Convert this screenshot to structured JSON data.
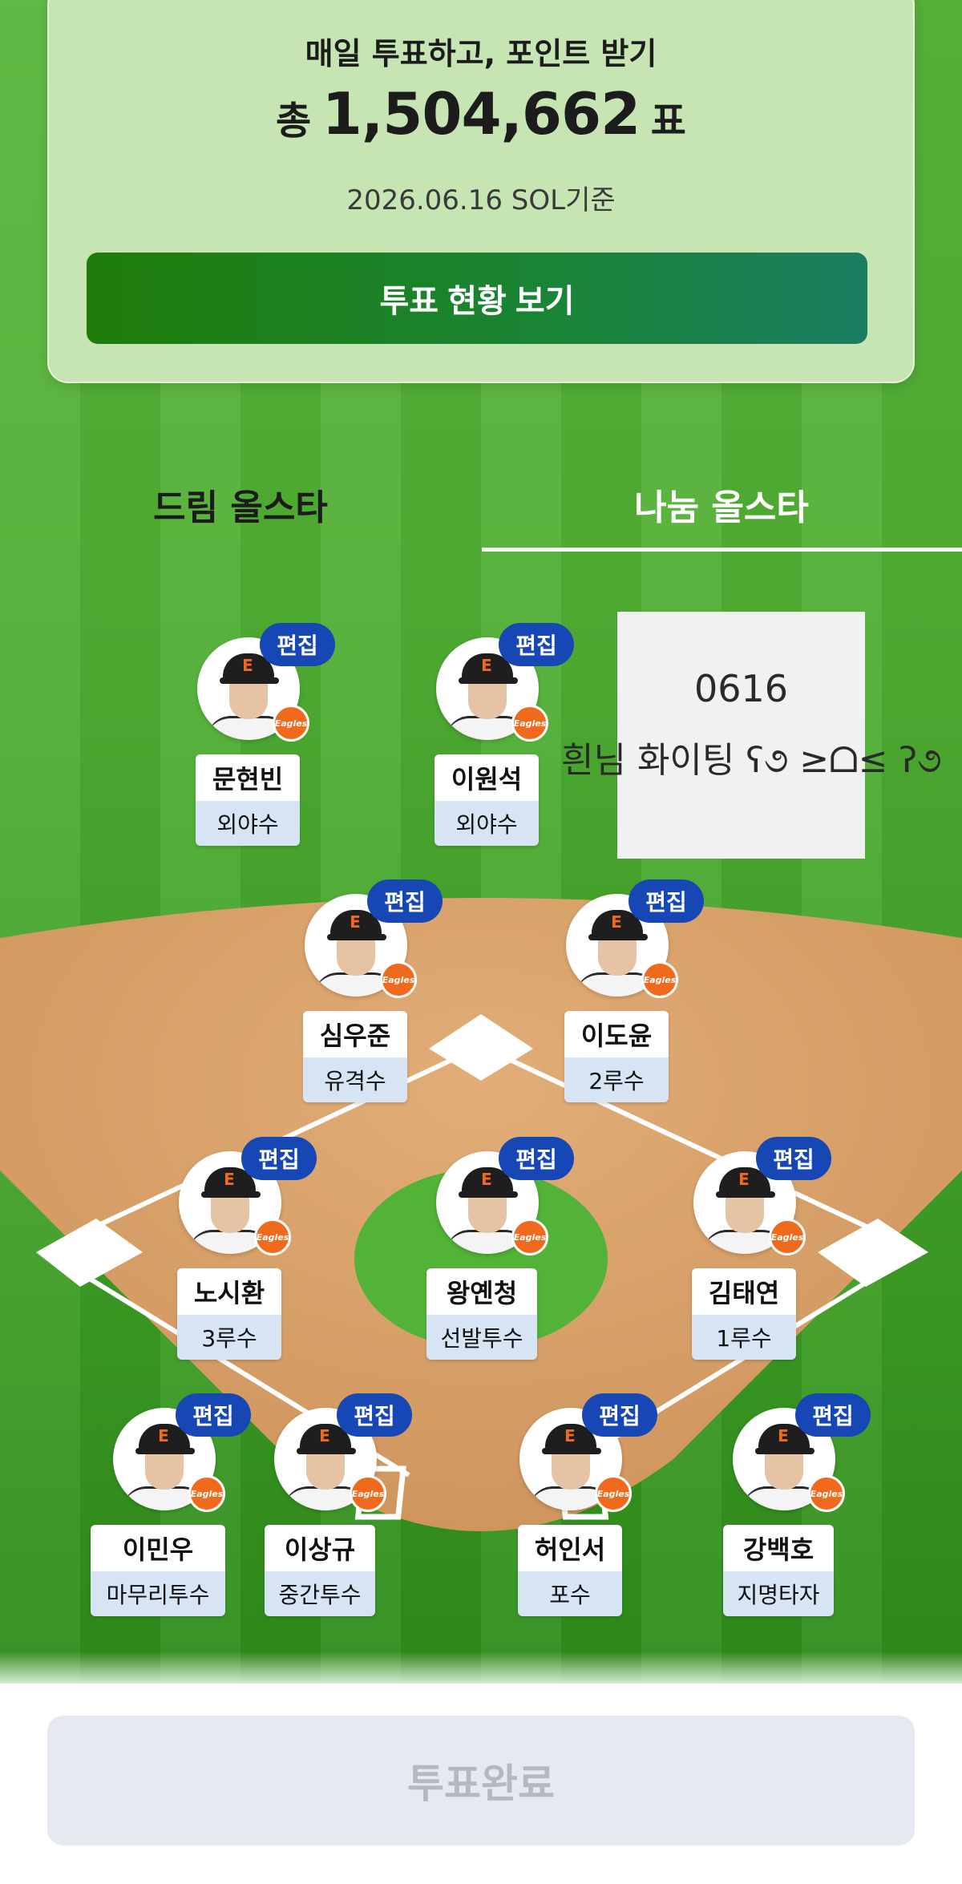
{
  "vote_card": {
    "heading": "매일 투표하고, 포인트 받기",
    "total_prefix": "총",
    "total_value": "1,504,662",
    "total_suffix": "표",
    "date_note": "2026.06.16 SOL기준",
    "status_button_label": "투표 현황 보기"
  },
  "tabs": [
    {
      "label": "드림 올스타",
      "active": false
    },
    {
      "label": "나눔 올스타",
      "active": true
    }
  ],
  "note": {
    "line1": "0616",
    "line2": "흰님 화이팅 ʕ૭ ≥ᗝ≤ ʔ૭"
  },
  "edit_label": "편집",
  "team_badge_text": "Eagles",
  "cap_letter": "E",
  "players": [
    {
      "name": "문현빈",
      "position": "외야수"
    },
    {
      "name": "이원석",
      "position": "외야수"
    },
    {
      "name": "심우준",
      "position": "유격수"
    },
    {
      "name": "이도윤",
      "position": "2루수"
    },
    {
      "name": "노시환",
      "position": "3루수"
    },
    {
      "name": "왕옌청",
      "position": "선발투수"
    },
    {
      "name": "김태연",
      "position": "1루수"
    },
    {
      "name": "이민우",
      "position": "마무리투수"
    },
    {
      "name": "이상규",
      "position": "중간투수"
    },
    {
      "name": "허인서",
      "position": "포수"
    },
    {
      "name": "강백호",
      "position": "지명타자"
    }
  ],
  "complete_button_label": "투표완료",
  "colors": {
    "card_bg": "#c6e5b3",
    "button_green": "#1e7d0a",
    "edit_blue": "#1747b5",
    "team_orange": "#ef6a1c",
    "position_bg": "#d6e4f4",
    "dirt": "#d9a06a"
  }
}
